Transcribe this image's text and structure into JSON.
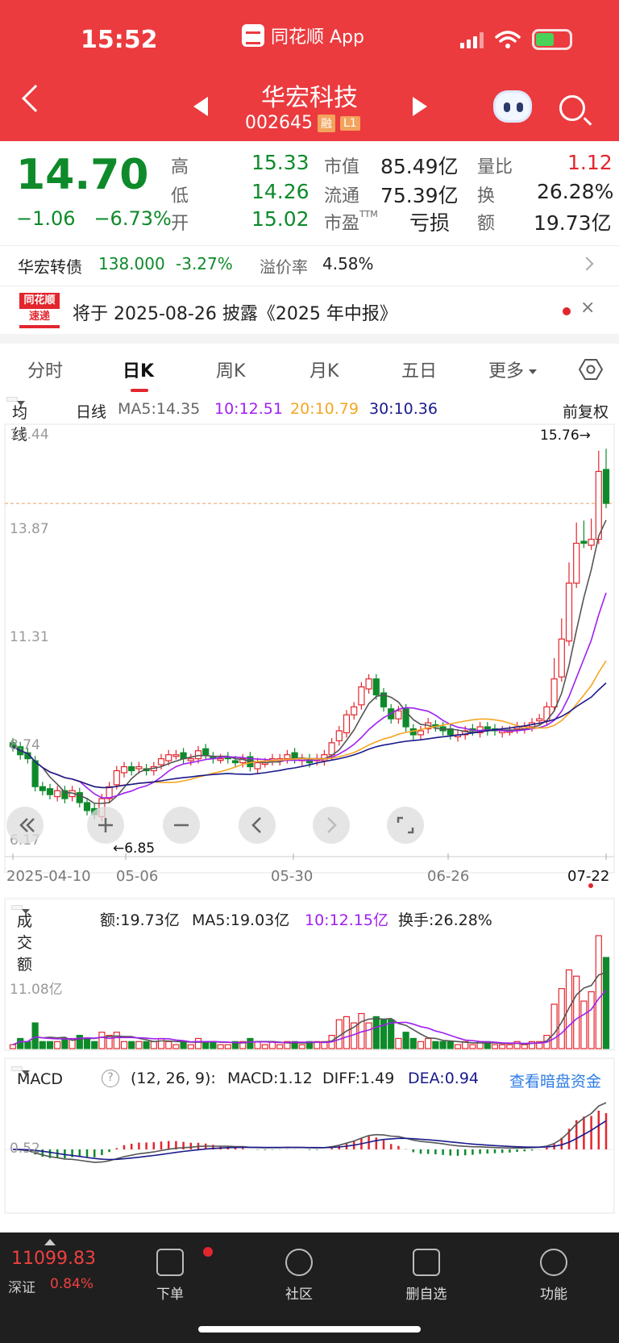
{
  "status": {
    "time": "15:52",
    "app": "同花顺 App"
  },
  "stock": {
    "name": "华宏科技",
    "code": "002645",
    "tag1": "融",
    "tag2": "L1"
  },
  "quote": {
    "price": "14.70",
    "change": "−1.06",
    "pct": "−6.73%",
    "labels": {
      "high": "高",
      "low": "低",
      "open": "开",
      "mktcap": "市值",
      "float": "流通",
      "pe": "市盈",
      "pe_sup": "TTM",
      "vol_ratio": "量比",
      "turnover": "换",
      "amount": "额"
    },
    "high": "15.33",
    "low": "14.26",
    "open": "15.02",
    "mktcap": "85.49亿",
    "float": "75.39亿",
    "pe": "亏损",
    "vol_ratio": "1.12",
    "turnover": "26.28%",
    "amount": "19.73亿"
  },
  "bond": {
    "name": "华宏转债",
    "price": "138.000",
    "pct": "-3.27%",
    "premium_label": "溢价率",
    "premium": "4.58%"
  },
  "notice": {
    "logo_top": "同花顺",
    "logo_bottom": "速递",
    "text": "将于 2025-08-26 披露《2025 年中报》",
    "close": "×"
  },
  "tabs": [
    "分时",
    "日K",
    "周K",
    "月K",
    "五日",
    "更多"
  ],
  "ma_row": {
    "type": "均线",
    "period": "日线",
    "ma5": "MA5:14.35",
    "ma10": "10:12.51",
    "ma20": "20:10.79",
    "ma30": "30:10.36",
    "adjust": "前复权"
  },
  "kline": {
    "y_labels": [
      "16.44",
      "13.87",
      "11.31",
      "8.74",
      "6.17"
    ],
    "high_label": "15.76→",
    "low_label": "←6.85",
    "dates": [
      "2025-04-10",
      "05-06",
      "05-30",
      "06-26",
      "07-22"
    ]
  },
  "volume": {
    "type": "成交额",
    "amount": "额:19.73亿",
    "ma5": "MA5:19.03亿",
    "ma10": "10:12.15亿",
    "turnover": "换手:26.28%",
    "y_label": "11.08亿"
  },
  "macd": {
    "type": "MACD",
    "help": "?",
    "params": "(12, 26, 9):",
    "macd": "MACD:1.12",
    "diff": "DIFF:1.49",
    "dea": "DEA:0.94",
    "link": "查看暗盘资金",
    "y_label": "0.52"
  },
  "bottom": {
    "index_value": "11099.83",
    "index_name": "深证",
    "index_pct": "0.84%",
    "items": [
      "下单",
      "社区",
      "删自选",
      "功能"
    ]
  },
  "colors": {
    "header": "#eb3b3f",
    "up": "#e3262e",
    "down": "#0e8a2a",
    "ma5": "#555555",
    "ma10": "#a020f0",
    "ma20": "#f5a623",
    "ma30": "#1a1a8c"
  },
  "chart_data": {
    "type": "candlestick",
    "ylim": [
      6.17,
      16.44
    ],
    "closes": [
      8.6,
      8.4,
      8.3,
      7.6,
      7.5,
      7.4,
      7.5,
      7.3,
      7.5,
      7.2,
      7.0,
      6.9,
      7.3,
      7.6,
      8.0,
      8.1,
      8.0,
      8.1,
      8.0,
      8.1,
      8.3,
      8.4,
      8.4,
      8.3,
      8.3,
      8.5,
      8.4,
      8.3,
      8.3,
      8.3,
      8.2,
      8.3,
      8.1,
      8.2,
      8.2,
      8.3,
      8.3,
      8.4,
      8.3,
      8.3,
      8.2,
      8.3,
      8.4,
      8.7,
      9.0,
      9.4,
      9.6,
      10.1,
      10.3,
      9.9,
      9.6,
      9.3,
      9.5,
      9.1,
      8.9,
      9.0,
      9.2,
      9.1,
      9.0,
      8.9,
      8.9,
      9.0,
      9.0,
      9.1,
      9.0,
      9.0,
      9.0,
      9.0,
      9.1,
      9.1,
      9.2,
      9.3,
      9.6,
      10.3,
      11.3,
      12.7,
      13.7,
      13.7,
      13.8,
      15.5,
      14.7
    ]
  }
}
